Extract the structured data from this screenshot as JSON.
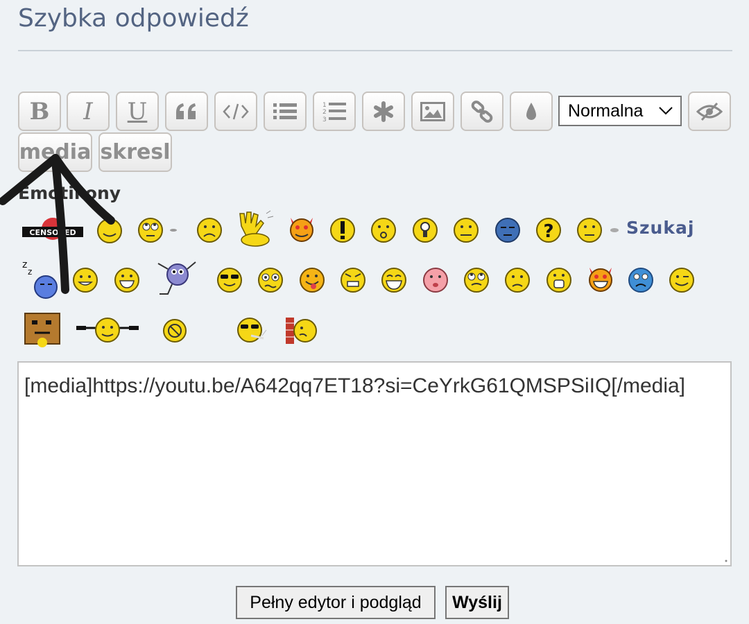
{
  "title": "Szybka odpowiedź",
  "toolbar": {
    "bold_label": "B",
    "italic_label": "I",
    "underline_label": "U",
    "font_size_value": "Normalna",
    "media_label": "media",
    "strike_label": "skresl"
  },
  "emoticons": {
    "label": "Emotikony",
    "search_label": "Szukaj",
    "censored_text": "CENSORED"
  },
  "message": {
    "value": "[media]https://youtu.be/A642qq7ET18?si=CeYrkG61QMSPSiIQ[/media]"
  },
  "buttons": {
    "preview_label": "Pełny edytor i podgląd",
    "submit_label": "Wyślij"
  },
  "colors": {
    "title": "#536482",
    "background": "#eef2f5",
    "smiley_yellow": "#f5d716",
    "annotation": "#1a1a1a"
  },
  "icons": [
    "quote-icon",
    "code-icon",
    "bullet-list-icon",
    "numbered-list-icon",
    "list-item-icon",
    "image-icon",
    "link-icon",
    "color-icon",
    "eye-off-icon"
  ]
}
